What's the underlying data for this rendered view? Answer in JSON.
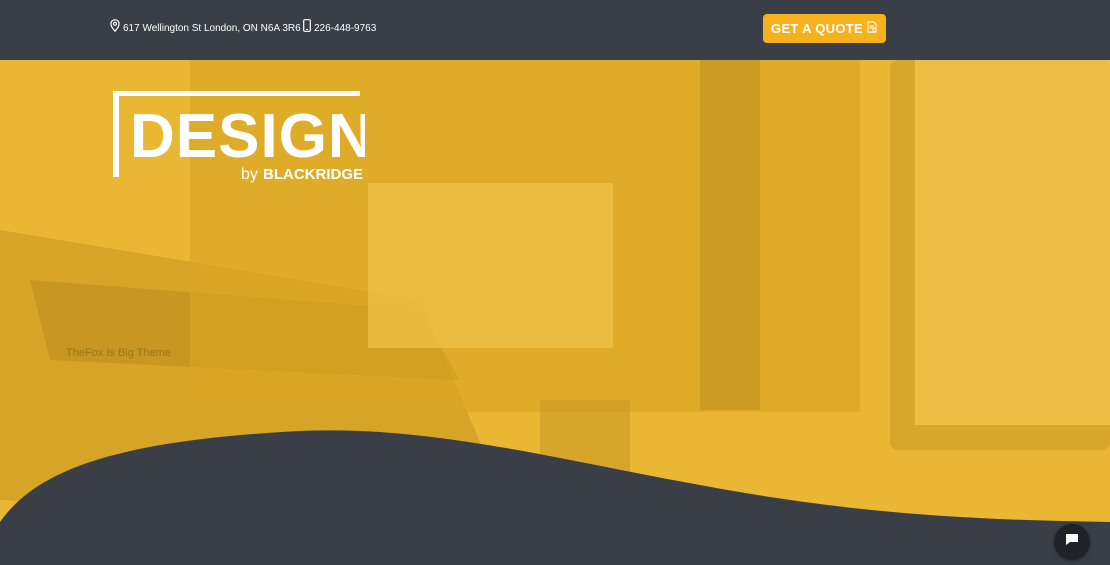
{
  "topbar": {
    "address": "617 Wellington St London, ON N6A 3R6",
    "phone": "226-448-9763",
    "quote_label": "GET A QUOTE"
  },
  "hero": {
    "logo_word": "DESIGN",
    "logo_by": "by",
    "logo_brand": "BLACKRIDGE",
    "overlay_color": "#e9b733",
    "background_description_visible_text": "TheFox Is Big Theme"
  },
  "colors": {
    "dark_bg": "#3a3f47",
    "accent": "#f5b21c",
    "chat_button": "#1f2227"
  },
  "icons": [
    "map-pin-icon",
    "mobile-phone-icon",
    "quote-doc-icon",
    "chat-bubble-icon"
  ]
}
